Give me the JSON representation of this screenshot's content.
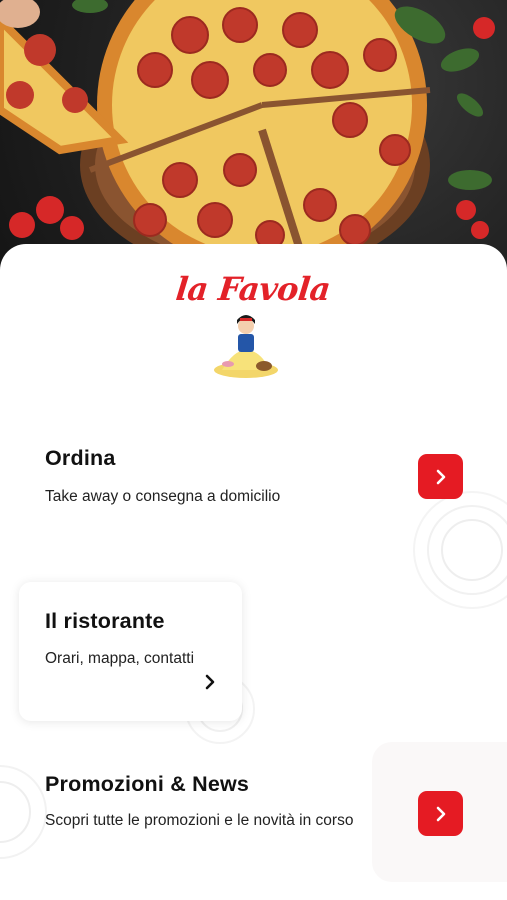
{
  "brand": {
    "logo_text": "la Favola",
    "accent_color": "#e51b23"
  },
  "hero": {
    "image": "pepperoni-pizza-photo"
  },
  "menu": [
    {
      "title": "Ordina",
      "description": "Take away o consegna a domicilio",
      "icon": "chevron-right-icon"
    },
    {
      "title": "Il ristorante",
      "description": "Orari, mappa, contatti",
      "icon": "chevron-right-icon"
    },
    {
      "title": "Promozioni & News",
      "description": "Scopri tutte le promozioni e le novità in corso",
      "icon": "chevron-right-icon"
    }
  ]
}
